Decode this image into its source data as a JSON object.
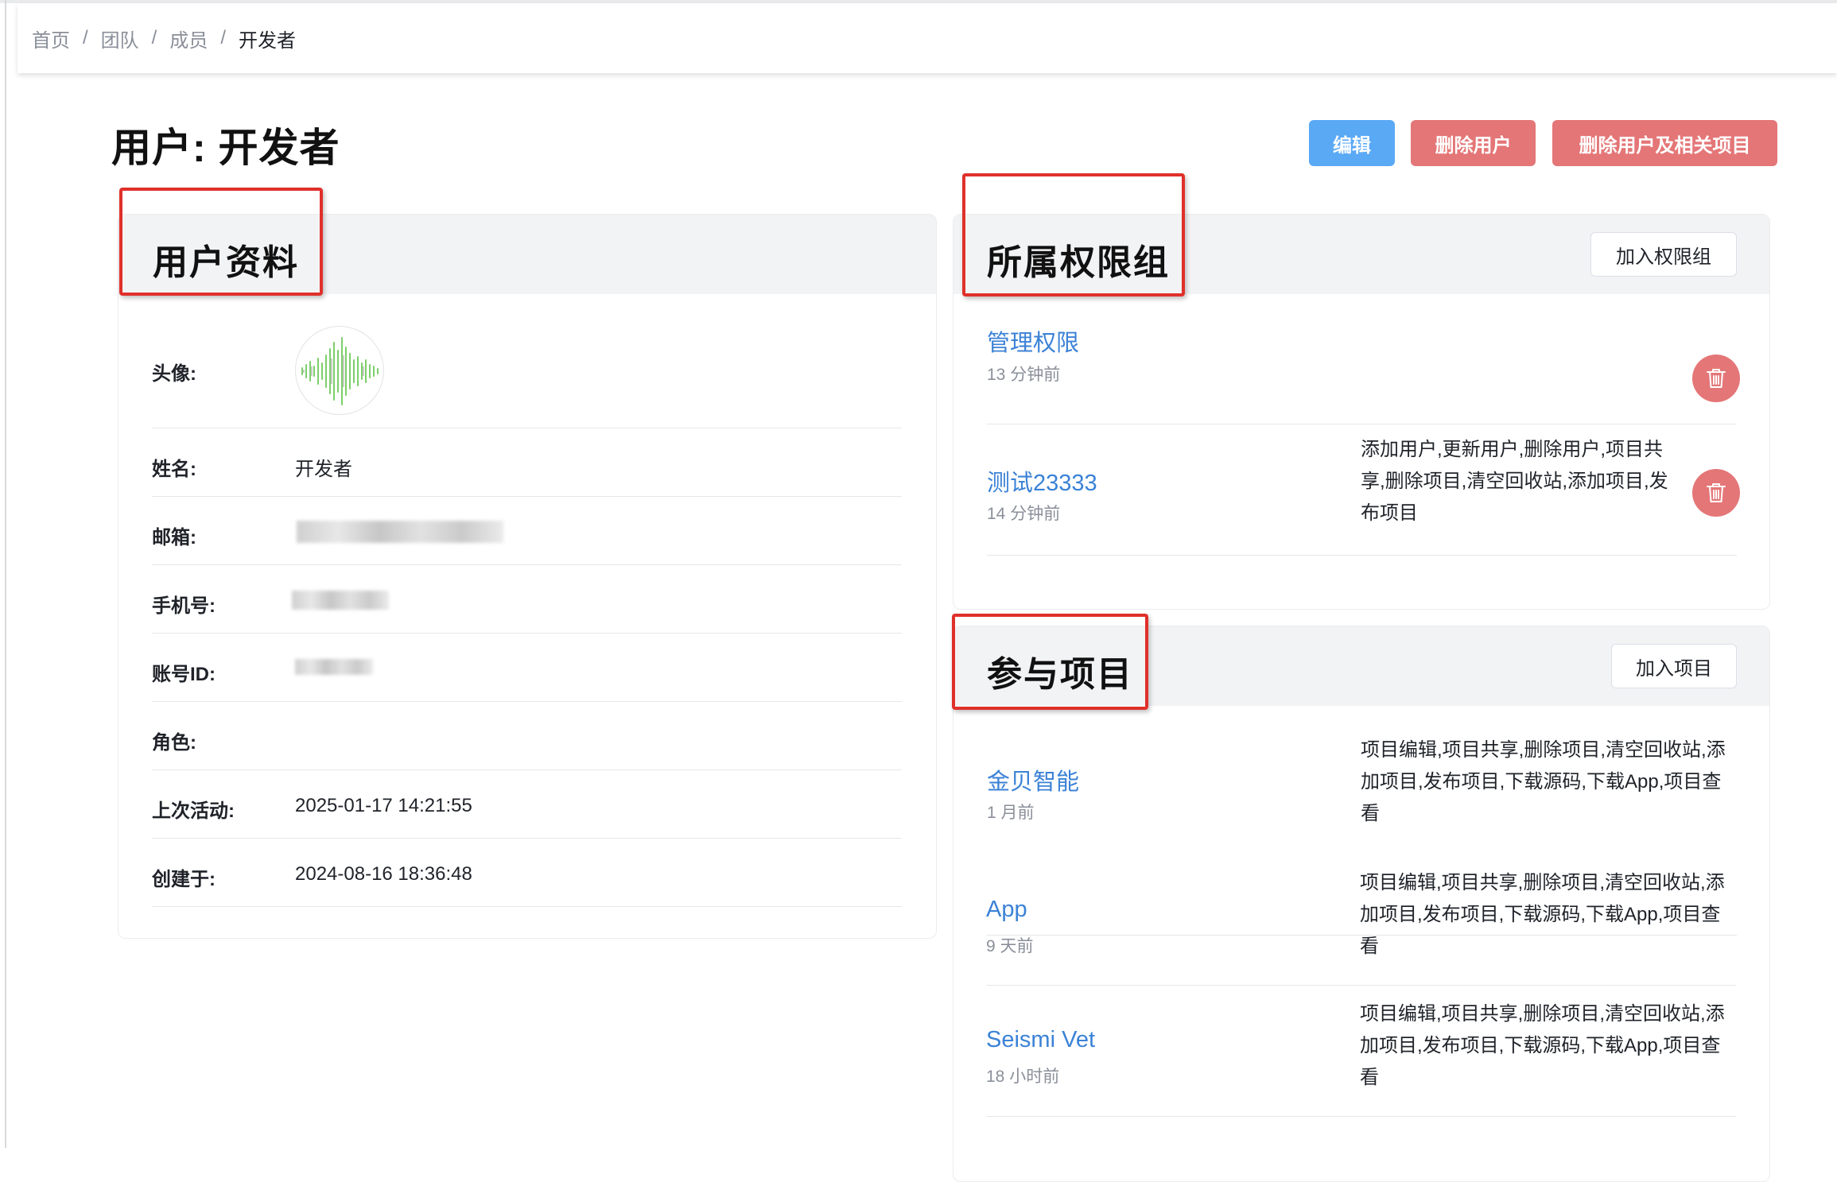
{
  "breadcrumb": {
    "items": [
      "首页",
      "团队",
      "成员"
    ],
    "separator": "/",
    "current": "开发者"
  },
  "page": {
    "title": "用户: 开发者"
  },
  "actions": {
    "edit": "编辑",
    "delete_user": "删除用户",
    "delete_user_and_projects": "删除用户及相关项目"
  },
  "profile": {
    "title": "用户资料",
    "rows": [
      {
        "label": "头像:",
        "value": ""
      },
      {
        "label": "姓名:",
        "value": "开发者"
      },
      {
        "label": "邮箱:",
        "value": ""
      },
      {
        "label": "手机号:",
        "value": ""
      },
      {
        "label": "账号ID:",
        "value": ""
      },
      {
        "label": "角色:",
        "value": ""
      },
      {
        "label": "上次活动:",
        "value": "2025-01-17 14:21:55"
      },
      {
        "label": "创建于:",
        "value": "2024-08-16 18:36:48"
      }
    ]
  },
  "permissions": {
    "title": "所属权限组",
    "add_button": "加入权限组",
    "items": [
      {
        "name": "管理权限",
        "time": "13 分钟前",
        "perms": ""
      },
      {
        "name": "测试23333",
        "time": "14 分钟前",
        "perms": "添加用户,更新用户,删除用户,项目共享,删除项目,清空回收站,添加项目,发布项目"
      }
    ]
  },
  "projects": {
    "title": "参与项目",
    "add_button": "加入项目",
    "items": [
      {
        "name": "金贝智能",
        "time": "1 月前",
        "perms": "项目编辑,项目共享,删除项目,清空回收站,添加项目,发布项目,下载源码,下载App,项目查看"
      },
      {
        "name": "App",
        "time": "9 天前",
        "perms": "项目编辑,项目共享,删除项目,清空回收站,添加项目,发布项目,下载源码,下载App,项目查看"
      },
      {
        "name": "Seismi Vet",
        "time": "18 小时前",
        "perms": "项目编辑,项目共享,删除项目,清空回收站,添加项目,发布项目,下载源码,下载App,项目查看"
      }
    ]
  },
  "colors": {
    "primary": "#5aa9f5",
    "danger": "#e47677",
    "link": "#3b82d6",
    "highlight": "#e0302a"
  },
  "icons": {
    "trash": "trash-icon",
    "avatar": "waveform-avatar"
  }
}
